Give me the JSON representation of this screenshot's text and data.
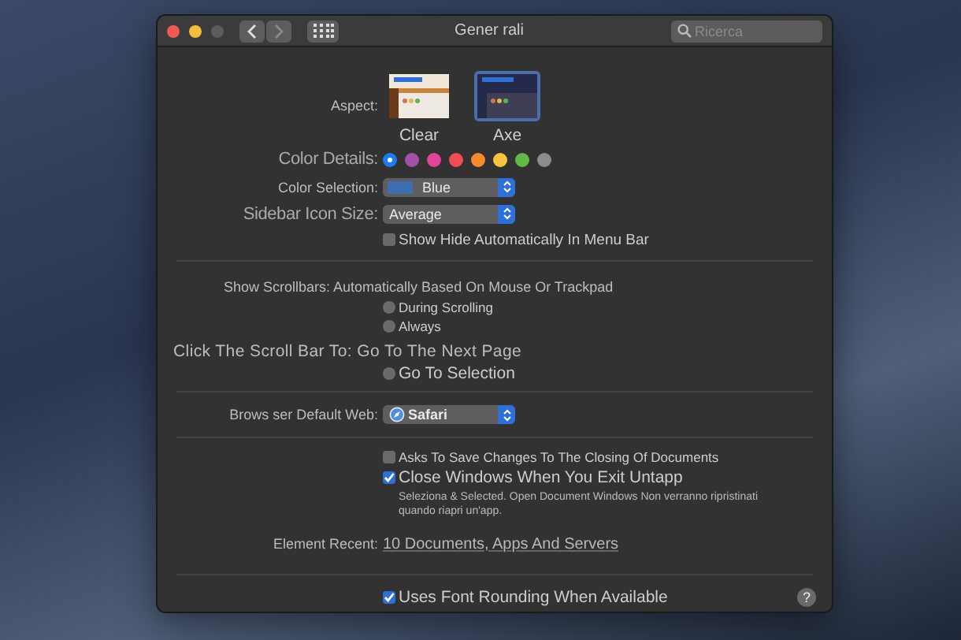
{
  "window": {
    "title": "Gener rali",
    "search": {
      "placeholder": "Ricerca"
    }
  },
  "appearance": {
    "label": "Aspect:",
    "options": [
      {
        "label": "Clear",
        "kind": "light",
        "selected": false
      },
      {
        "label": "Axe",
        "kind": "dark",
        "selected": true
      }
    ]
  },
  "accent": {
    "label": "Color Details:",
    "colors": [
      {
        "color": "#1e7cf2",
        "selected": true
      },
      {
        "color": "#a550a7",
        "selected": false
      },
      {
        "color": "#e0459a",
        "selected": false
      },
      {
        "color": "#f24c57",
        "selected": false
      },
      {
        "color": "#f58b2a",
        "selected": false
      },
      {
        "color": "#f6c343",
        "selected": false
      },
      {
        "color": "#62ba46",
        "selected": false
      },
      {
        "color": "#8c8c8c",
        "selected": false
      }
    ]
  },
  "highlight": {
    "label": "Color Selection:",
    "value": "Blue",
    "color": "#3d6fb0"
  },
  "sidebar_size": {
    "label": "Sidebar Icon Size:",
    "value": "Average"
  },
  "menu_bar": {
    "label": "Show Hide Automatically In Menu Bar",
    "checked": false
  },
  "scrollbars": {
    "label": "Show Scrollbars: Automatically Based On Mouse Or Trackpad",
    "options": [
      {
        "label": "During Scrolling",
        "selected": false
      },
      {
        "label": "Always",
        "selected": false
      }
    ]
  },
  "click_scroll": {
    "label": "Click The Scroll Bar To: Go To The Next Page",
    "options": [
      {
        "label": "Go To Selection",
        "selected": false
      }
    ]
  },
  "browser": {
    "label": "Brows ser Default Web:",
    "value": "Safari"
  },
  "documents": [
    {
      "label": "Asks To Save Changes To The Closing Of Documents",
      "checked": false
    },
    {
      "label": "Close Windows When You Exit Untapp",
      "checked": true
    }
  ],
  "documents_note": "Seleziona & Selected. Open Document Windows Non verranno ripristinati quando riapri un'app.",
  "recent": {
    "label": "Element Recent:",
    "value": "10 Documents, Apps And Servers"
  },
  "font_smoothing": {
    "label": "Uses Font Rounding When Available",
    "checked": true
  },
  "help": "?"
}
